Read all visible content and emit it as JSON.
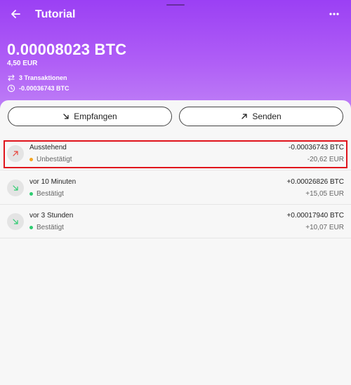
{
  "app": {
    "title": "Tutorial"
  },
  "wallet": {
    "balance": "0.00008023 BTC",
    "fiat": "4,50 EUR",
    "tx_count": "3 Transaktionen",
    "pending": "-0.00036743 BTC"
  },
  "actions": {
    "receive_label": "Empfangen",
    "send_label": "Senden"
  },
  "transactions": [
    {
      "label": "Ausstehend",
      "status": "Unbestätigt",
      "amount": "-0.00036743 BTC",
      "fiat": "-20,62 EUR",
      "direction": "outgoing",
      "status_color": "#f5a623",
      "icon": "arrow-up-right-icon"
    },
    {
      "label": "vor 10 Minuten",
      "status": "Bestätigt",
      "amount": "+0.00026826 BTC",
      "fiat": "+15,05 EUR",
      "direction": "incoming",
      "status_color": "#2ecc71",
      "icon": "arrow-down-right-icon"
    },
    {
      "label": "vor 3 Stunden",
      "status": "Bestätigt",
      "amount": "+0.00017940 BTC",
      "fiat": "+10,07 EUR",
      "direction": "incoming",
      "status_color": "#2ecc71",
      "icon": "arrow-down-right-icon"
    }
  ],
  "icons": {
    "back": "arrow-left-icon",
    "menu": "more-vert-icon",
    "transfer": "swap-icon",
    "clock": "clock-icon"
  },
  "colors": {
    "header_top": "#9b40f4",
    "outgoing": "#e8453c",
    "incoming": "#2ecc71",
    "highlight": "#e0141c"
  }
}
